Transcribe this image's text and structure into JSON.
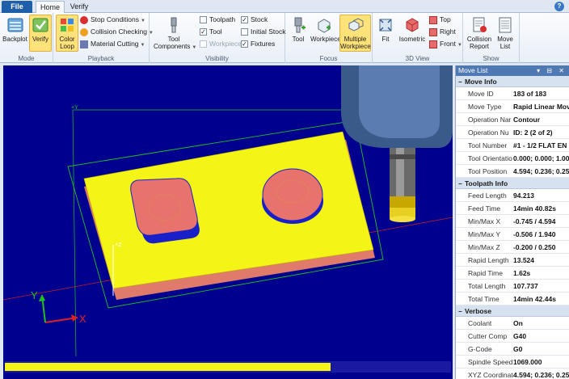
{
  "tabs": {
    "file": "File",
    "home": "Home",
    "verify": "Verify"
  },
  "ribbon": {
    "mode": {
      "label": "Mode",
      "backplot": "Backplot",
      "verify": "Verify"
    },
    "playback": {
      "label": "Playback",
      "color_loop_1": "Color",
      "color_loop_2": "Loop",
      "stop_conditions": "Stop Conditions",
      "collision_checking": "Collision Checking",
      "material_cutting": "Material Cutting"
    },
    "visibility": {
      "label": "Visibility",
      "tool_components_1": "Tool",
      "tool_components_2": "Components",
      "toolpath": "Toolpath",
      "tool": "Tool",
      "workpiece": "Workpiece",
      "stock": "Stock",
      "initial_stock": "Initial Stock",
      "fixtures": "Fixtures"
    },
    "focus": {
      "label": "Focus",
      "tool": "Tool",
      "workpiece": "Workpiece",
      "multiple_1": "Multiple",
      "multiple_2": "Workpiece"
    },
    "view3d": {
      "label": "3D View",
      "fit": "Fit",
      "isometric": "Isometric",
      "top": "Top",
      "right": "Right",
      "front": "Front"
    },
    "show": {
      "label": "Show",
      "collision_1": "Collision",
      "collision_2": "Report",
      "move_1": "Move",
      "move_2": "List"
    }
  },
  "viewport": {
    "axis_y": "Y",
    "axis_x": "X",
    "axis_z_small": "+Z",
    "axis_y_small": "+Y",
    "progress": 0.735
  },
  "panel": {
    "title": "Move List",
    "move_info": {
      "title": "Move Info",
      "rows": [
        {
          "k": "Move ID",
          "v": "183 of 183"
        },
        {
          "k": "Move Type",
          "v": "Rapid Linear Mov"
        },
        {
          "k": "Operation Nar",
          "v": "Contour"
        },
        {
          "k": "Operation Nu",
          "v": "ID: 2 (2 of 2)"
        },
        {
          "k": "Tool Number",
          "v": "#1 - 1/2 FLAT EN"
        },
        {
          "k": "Tool Orientatio",
          "v": "0.000; 0.000; 1.00"
        },
        {
          "k": "Tool Position",
          "v": "4.594; 0.236; 0.25"
        }
      ]
    },
    "toolpath_info": {
      "title": "Toolpath Info",
      "rows": [
        {
          "k": "Feed Length",
          "v": "94.213"
        },
        {
          "k": "Feed Time",
          "v": "14min 40.82s"
        },
        {
          "k": "Min/Max X",
          "v": "-0.745 / 4.594"
        },
        {
          "k": "Min/Max Y",
          "v": "-0.506 / 1.940"
        },
        {
          "k": "Min/Max Z",
          "v": "-0.200 / 0.250"
        },
        {
          "k": "Rapid Length",
          "v": "13.524"
        },
        {
          "k": "Rapid Time",
          "v": "1.62s"
        },
        {
          "k": "Total Length",
          "v": "107.737"
        },
        {
          "k": "Total Time",
          "v": "14min 42.44s"
        }
      ]
    },
    "verbose": {
      "title": "Verbose",
      "rows": [
        {
          "k": "Coolant",
          "v": "On"
        },
        {
          "k": "Cutter Comp",
          "v": "G40"
        },
        {
          "k": "G-Code",
          "v": "G0"
        },
        {
          "k": "Spindle Speed",
          "v": "1069.000"
        },
        {
          "k": "XYZ Coordinat",
          "v": "4.594; 0.236; 0.25"
        }
      ]
    }
  }
}
